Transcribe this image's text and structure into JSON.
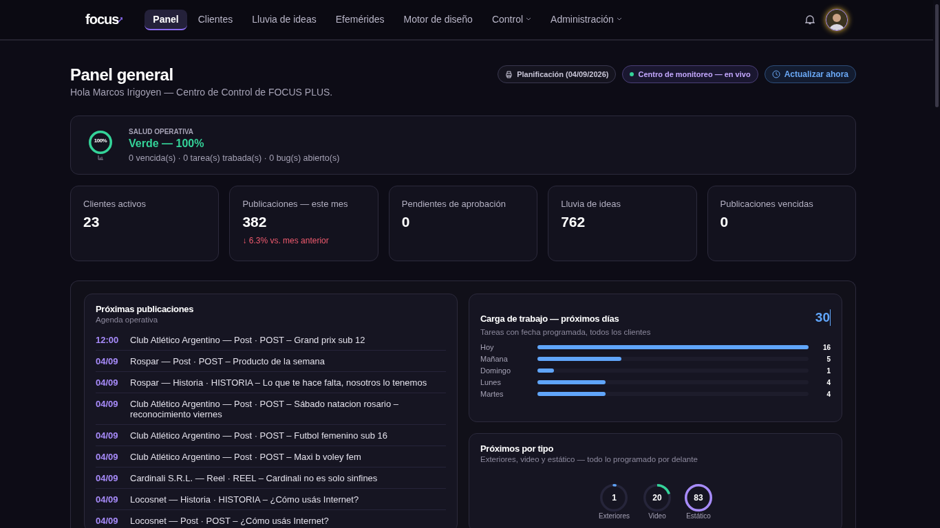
{
  "nav": {
    "logo": "focus",
    "items": [
      {
        "label": "Panel",
        "selected": true,
        "dropdown": false
      },
      {
        "label": "Clientes",
        "selected": false,
        "dropdown": false
      },
      {
        "label": "Lluvia de ideas",
        "selected": false,
        "dropdown": false
      },
      {
        "label": "Efemérides",
        "selected": false,
        "dropdown": false
      },
      {
        "label": "Motor de diseño",
        "selected": false,
        "dropdown": false
      },
      {
        "label": "Control",
        "selected": false,
        "dropdown": true
      },
      {
        "label": "Administración",
        "selected": false,
        "dropdown": true
      }
    ]
  },
  "header": {
    "title": "Panel general",
    "subtitle": "Hola Marcos Irigoyen — Centro de Control de FOCUS PLUS.",
    "actions": [
      {
        "kind": "print",
        "label": "Planificación (04/09/2026)"
      },
      {
        "kind": "live",
        "label": "Centro de monitoreo — en vivo"
      },
      {
        "kind": "refresh",
        "label": "Actualizar ahora"
      }
    ]
  },
  "health": {
    "ring_label": "100%",
    "level": 1,
    "eyebrow": "SALUD OPERATIVA",
    "status": "Verde — 100%",
    "details": "0 vencida(s) · 0 tarea(s) trabada(s) · 0 bug(s) abierto(s)"
  },
  "stats": [
    {
      "label": "Clientes activos",
      "value": "23"
    },
    {
      "label": "Publicaciones — este mes",
      "value": "382",
      "trend": "↓ 6.3% vs. mes anterior"
    },
    {
      "label": "Pendientes de aprobación",
      "value": "0"
    },
    {
      "label": "Lluvia de ideas",
      "value": "762"
    },
    {
      "label": "Publicaciones vencidas",
      "value": "0"
    }
  ],
  "upcoming": {
    "title": "Próximas publicaciones",
    "subtitle": "Agenda operativa",
    "items": [
      {
        "when": "12:00",
        "text": "Club Atlético Argentino — Post · POST – Grand prix sub 12"
      },
      {
        "when": "04/09",
        "text": "Rospar — Post · POST – Producto de la semana"
      },
      {
        "when": "04/09",
        "text": "Rospar — Historia · HISTORIA – Lo que te hace falta, nosotros lo tenemos"
      },
      {
        "when": "04/09",
        "text": "Club Atlético Argentino — Post · POST – Sábado natacion rosario – reconocimiento viernes"
      },
      {
        "when": "04/09",
        "text": "Club Atlético Argentino — Post · POST – Futbol femenino sub 16"
      },
      {
        "when": "04/09",
        "text": "Club Atlético Argentino — Post · POST – Maxi b voley fem"
      },
      {
        "when": "04/09",
        "text": "Cardinali S.R.L. — Reel · REEL – Cardinali no es solo sinfines"
      },
      {
        "when": "04/09",
        "text": "Locosnet — Historia · HISTORIA – ¿Cómo usás Internet?"
      },
      {
        "when": "04/09",
        "text": "Locosnet — Post · POST – ¿Cómo usás Internet?"
      }
    ]
  },
  "workload": {
    "title": "Carga de trabajo — próximos días",
    "subtitle": "Tareas con fecha programada, todos los clientes",
    "total": "30",
    "rows": [
      {
        "day": "Hoy",
        "level": 1,
        "count": "16"
      },
      {
        "day": "Mañana",
        "level": 0.31,
        "count": "5"
      },
      {
        "day": "Domingo",
        "level": 0.06,
        "count": "1"
      },
      {
        "day": "Lunes",
        "level": 0.25,
        "count": "4"
      },
      {
        "day": "Martes",
        "level": 0.25,
        "count": "4"
      }
    ]
  },
  "by_type": {
    "title": "Próximos por tipo",
    "subtitle": "Exteriores, video y estático — todo lo programado por delante",
    "rings": [
      {
        "label": "Exteriores",
        "value": "1",
        "level": 0.02,
        "color": "#60a5fa"
      },
      {
        "label": "Video",
        "value": "20",
        "level": 0.2,
        "color": "#34d399"
      },
      {
        "label": "Estático",
        "value": "83",
        "level": 1,
        "color": "#a78bfa"
      }
    ]
  }
}
